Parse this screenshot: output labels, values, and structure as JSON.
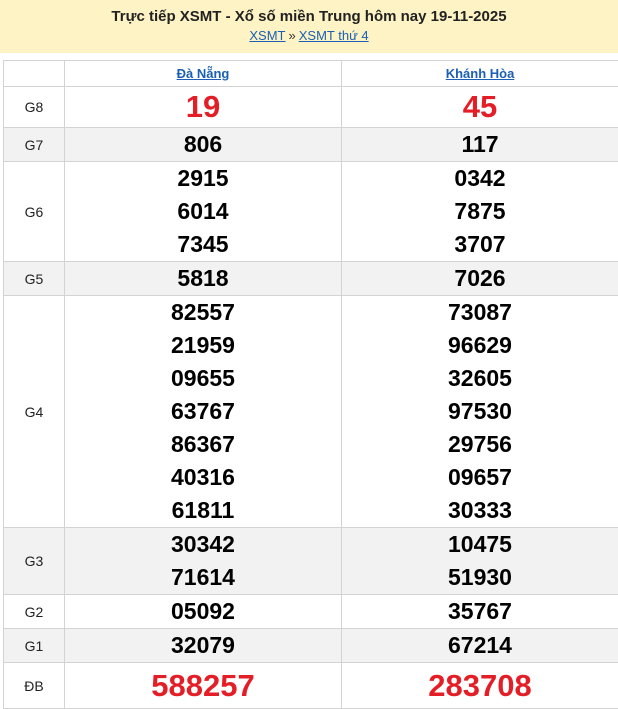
{
  "header": {
    "title": "Trực tiếp XSMT - Xổ số miền Trung hôm nay 19-11-2025",
    "crumb1": "XSMT",
    "separator": "»",
    "crumb2": "XSMT thứ 4"
  },
  "provinces": [
    "Đà Nẵng",
    "Khánh Hòa"
  ],
  "colors": {
    "special": "#e41e26",
    "link": "#1a5fb4",
    "header_bg": "#fdf3c4",
    "alt_row": "#f2f2f2"
  },
  "prizes": [
    {
      "label": "G8",
      "values": [
        [
          "19"
        ],
        [
          "45"
        ]
      ]
    },
    {
      "label": "G7",
      "values": [
        [
          "806"
        ],
        [
          "117"
        ]
      ]
    },
    {
      "label": "G6",
      "values": [
        [
          "2915",
          "6014",
          "7345"
        ],
        [
          "0342",
          "7875",
          "3707"
        ]
      ]
    },
    {
      "label": "G5",
      "values": [
        [
          "5818"
        ],
        [
          "7026"
        ]
      ]
    },
    {
      "label": "G4",
      "values": [
        [
          "82557",
          "21959",
          "09655",
          "63767",
          "86367",
          "40316",
          "61811"
        ],
        [
          "73087",
          "96629",
          "32605",
          "97530",
          "29756",
          "09657",
          "30333"
        ]
      ]
    },
    {
      "label": "G3",
      "values": [
        [
          "30342",
          "71614"
        ],
        [
          "10475",
          "51930"
        ]
      ]
    },
    {
      "label": "G2",
      "values": [
        [
          "05092"
        ],
        [
          "35767"
        ]
      ]
    },
    {
      "label": "G1",
      "values": [
        [
          "32079"
        ],
        [
          "67214"
        ]
      ]
    },
    {
      "label": "ĐB",
      "values": [
        [
          "588257"
        ],
        [
          "283708"
        ]
      ]
    }
  ]
}
